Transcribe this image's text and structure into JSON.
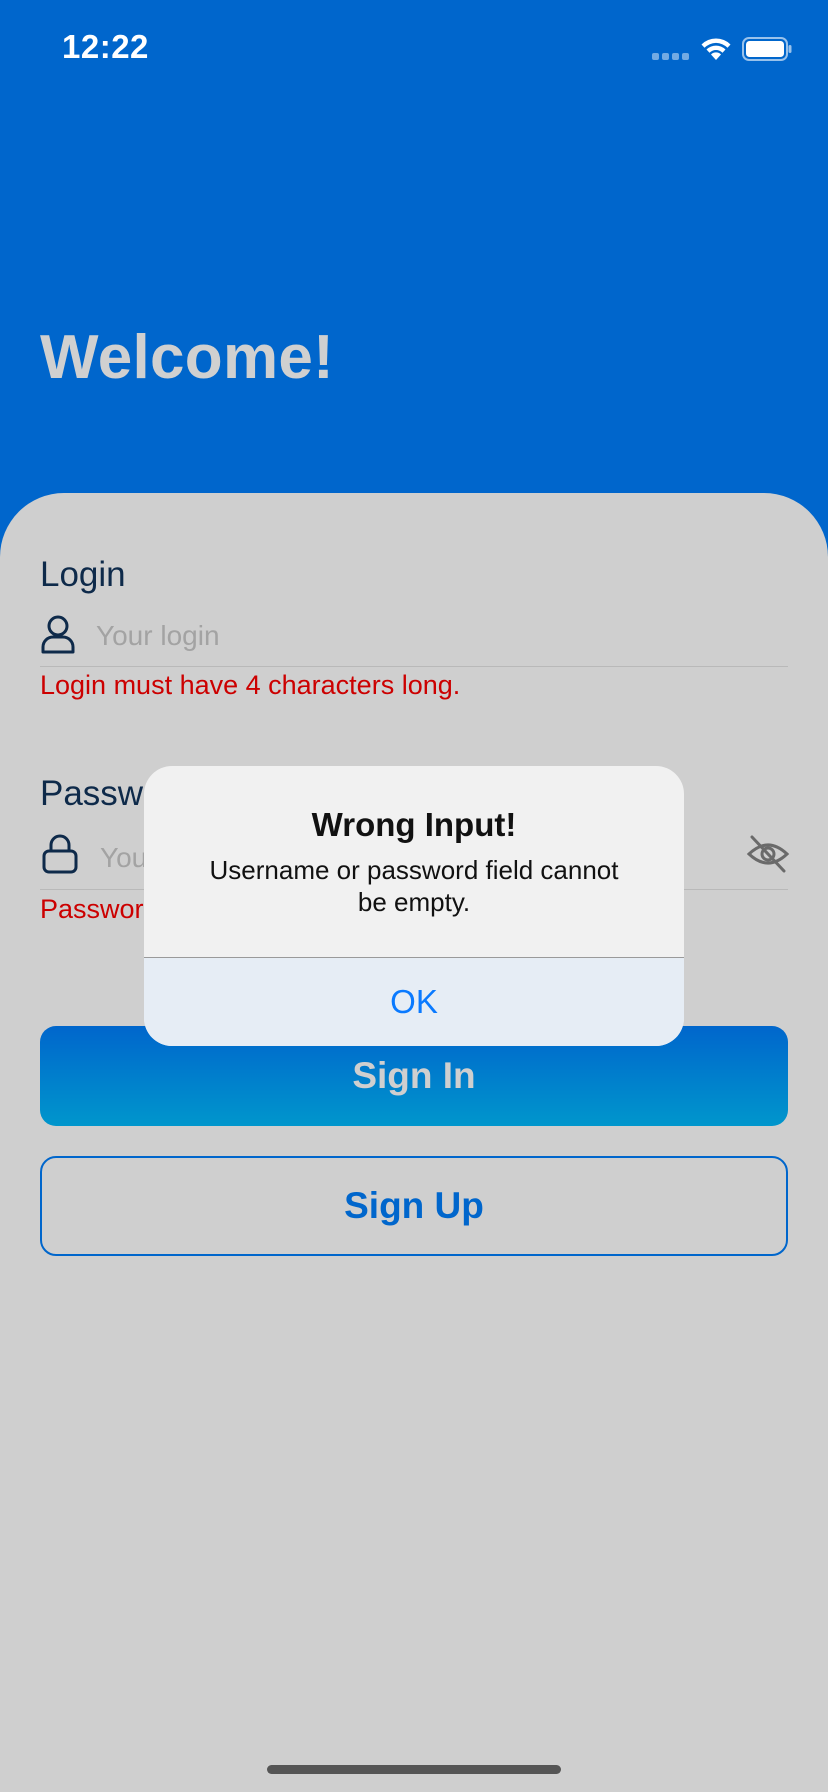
{
  "status_bar": {
    "time": "12:22"
  },
  "header": {
    "title": "Welcome!"
  },
  "login_field": {
    "label": "Login",
    "placeholder": "Your login",
    "icon": "user-icon",
    "error": "Login must have 4 characters long."
  },
  "password_field": {
    "label": "Password",
    "placeholder": "Your password",
    "icon": "lock-icon",
    "visibility_icon": "eye-slash-icon",
    "error": "Password"
  },
  "buttons": {
    "sign_in": "Sign In",
    "sign_up": "Sign Up"
  },
  "alert": {
    "title": "Wrong Input!",
    "message": "Username or password field cannot be empty.",
    "ok": "OK"
  },
  "colors": {
    "primary": "#0066cc",
    "sheet_background": "#cfcfcf",
    "error": "#cc0000",
    "alert_button": "#0a7aff"
  }
}
